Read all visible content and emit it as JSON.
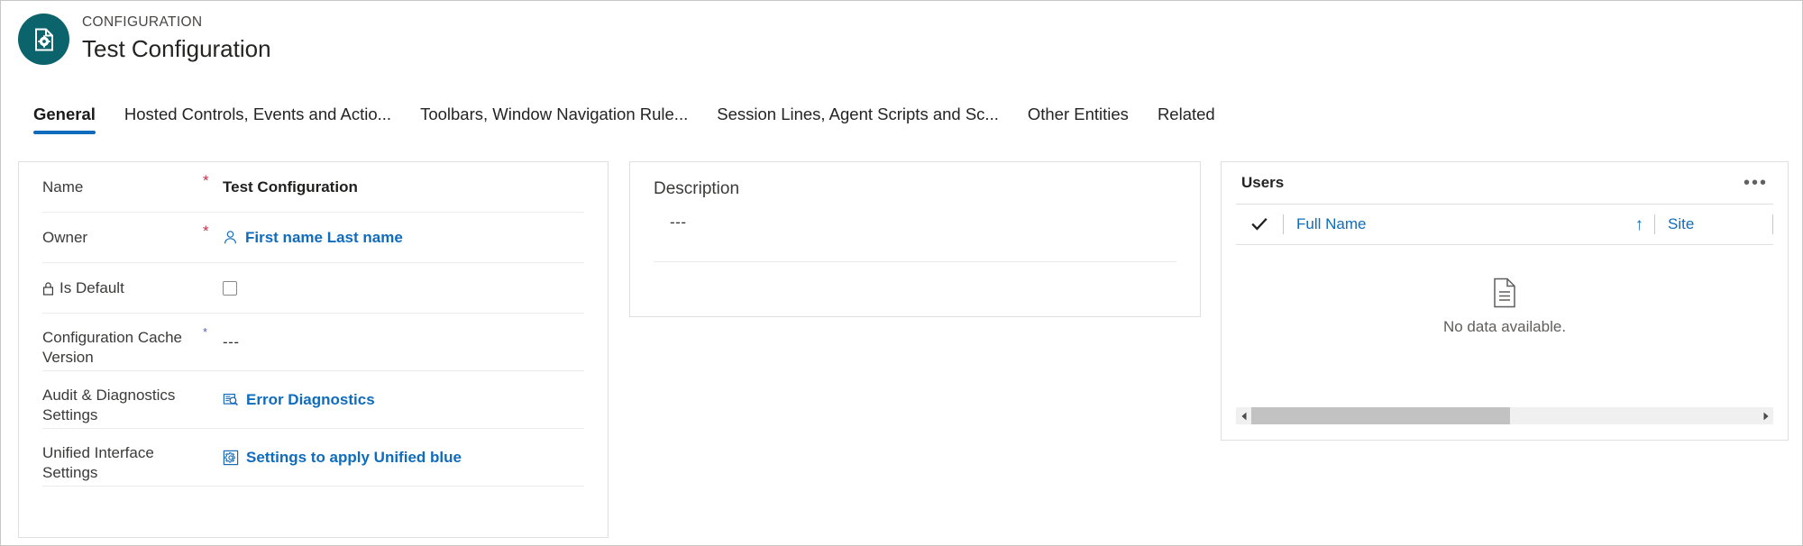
{
  "header": {
    "eyebrow": "CONFIGURATION",
    "title": "Test Configuration",
    "avatar_icon": "document-gear-icon",
    "avatar_color": "#0b636c"
  },
  "tabs": [
    {
      "label": "General",
      "active": true
    },
    {
      "label": "Hosted Controls, Events and Actio...",
      "active": false
    },
    {
      "label": "Toolbars, Window Navigation Rule...",
      "active": false
    },
    {
      "label": "Session Lines, Agent Scripts and Sc...",
      "active": false
    },
    {
      "label": "Other Entities",
      "active": false
    },
    {
      "label": "Related",
      "active": false
    }
  ],
  "theme": {
    "link_blue": "#0f6cbd",
    "required_red": "#c4314b",
    "accent_underline": "#0f6cbd"
  },
  "form": {
    "rows": [
      {
        "label": "Name",
        "required": true,
        "value": "Test Configuration",
        "value_type": "text",
        "lock": false
      },
      {
        "label": "Owner",
        "required": true,
        "value": "First name Last name",
        "value_type": "lookup",
        "icon": "person-icon",
        "lock": false
      },
      {
        "label": "Is Default",
        "required": false,
        "value": "",
        "value_type": "checkbox",
        "checked": false,
        "lock": true,
        "lock_icon": "lock-icon"
      },
      {
        "label": "Configuration Cache Version",
        "required": true,
        "value": "---",
        "value_type": "text-muted",
        "lock": false
      },
      {
        "label": "Audit & Diagnostics Settings",
        "required": false,
        "value": "Error Diagnostics",
        "value_type": "lookup",
        "icon": "diagnostics-icon",
        "lock": false
      },
      {
        "label": "Unified Interface Settings",
        "required": false,
        "value": "Settings to apply Unified blue",
        "value_type": "lookup",
        "icon": "gear-square-icon",
        "lock": false
      }
    ]
  },
  "description": {
    "label": "Description",
    "value": "---"
  },
  "users_grid": {
    "title": "Users",
    "more_label": "•••",
    "columns": [
      {
        "label": "Full Name",
        "sorted": true,
        "sort_direction": "↑"
      },
      {
        "label": "Site",
        "sorted": false,
        "sort_direction": ""
      }
    ],
    "select_all_icon": "checkmark-icon",
    "empty_icon": "empty-document-icon",
    "empty_text": "No data available.",
    "scrollbar": {
      "left_arrow": "caret-left-icon",
      "right_arrow": "caret-right-icon"
    }
  }
}
